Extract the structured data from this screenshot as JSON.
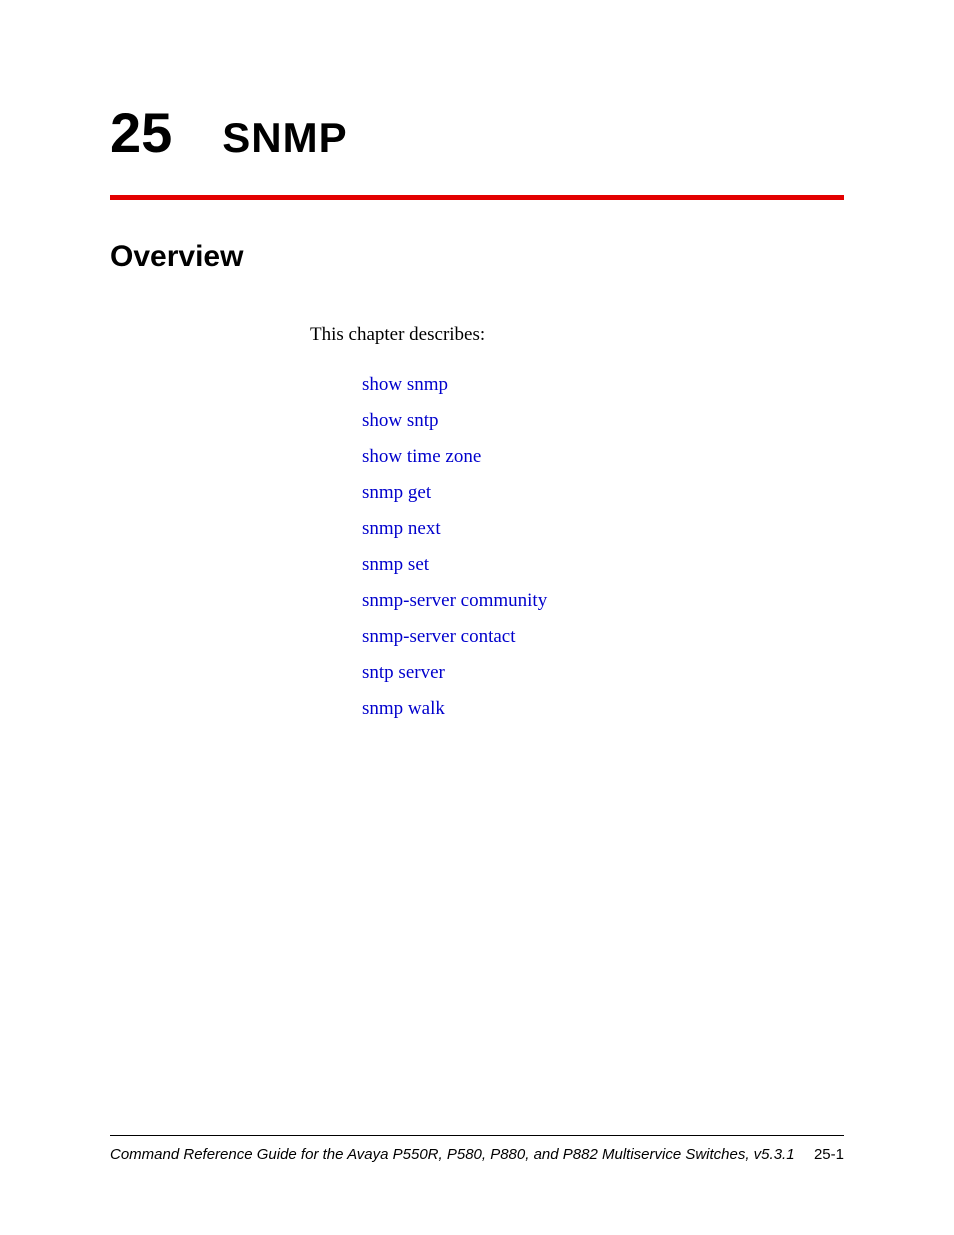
{
  "chapter": {
    "number": "25",
    "title": "SNMP"
  },
  "section": {
    "title": "Overview",
    "intro": "This chapter describes:"
  },
  "links": [
    "show snmp",
    "show sntp",
    "show time zone",
    "snmp get",
    "snmp next",
    "snmp set",
    "snmp-server community",
    "snmp-server contact",
    "sntp server",
    "snmp walk"
  ],
  "footer": {
    "left": "Command Reference Guide for the Avaya P550R, P580, P880, and P882 Multiservice Switches, v5.3.1",
    "right": "25-1"
  }
}
